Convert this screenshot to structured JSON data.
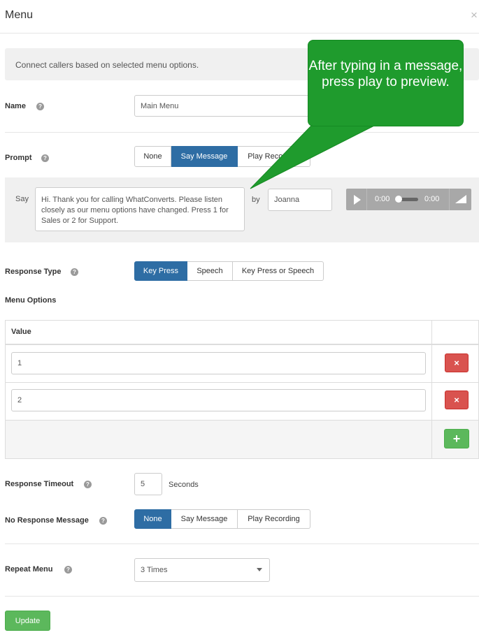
{
  "dialog": {
    "title": "Menu",
    "close": "×"
  },
  "info": "Connect callers based on selected menu options.",
  "name": {
    "label": "Name",
    "value": "Main Menu"
  },
  "prompt": {
    "label": "Prompt",
    "options": [
      "None",
      "Say Message",
      "Play Recording"
    ],
    "selected": "Say Message"
  },
  "say": {
    "label": "Say",
    "message": "Hi. Thank you for calling WhatConverts. Please listen closely as our menu options have changed. Press 1 for Sales or 2 for Support.",
    "by_label": "by",
    "voice": "Joanna"
  },
  "audio": {
    "current": "0:00",
    "duration": "0:00"
  },
  "response_type": {
    "label": "Response Type",
    "options": [
      "Key Press",
      "Speech",
      "Key Press or Speech"
    ],
    "selected": "Key Press"
  },
  "menu_options": {
    "label": "Menu Options",
    "column": "Value",
    "rows": [
      {
        "value": "1",
        "delete": "×"
      },
      {
        "value": "2",
        "delete": "×"
      }
    ],
    "add": "+"
  },
  "response_timeout": {
    "label": "Response Timeout",
    "value": "5",
    "unit": "Seconds"
  },
  "no_response": {
    "label": "No Response Message",
    "options": [
      "None",
      "Say Message",
      "Play Recording"
    ],
    "selected": "None"
  },
  "repeat_menu": {
    "label": "Repeat Menu",
    "value": "3 Times"
  },
  "update_button": "Update",
  "callout": "After typing in a message, press play to preview.",
  "help_glyph": "?",
  "colors": {
    "primary": "#2e6da4",
    "success": "#5cb85c",
    "danger": "#d9534f",
    "callout": "#1f9b2d"
  }
}
